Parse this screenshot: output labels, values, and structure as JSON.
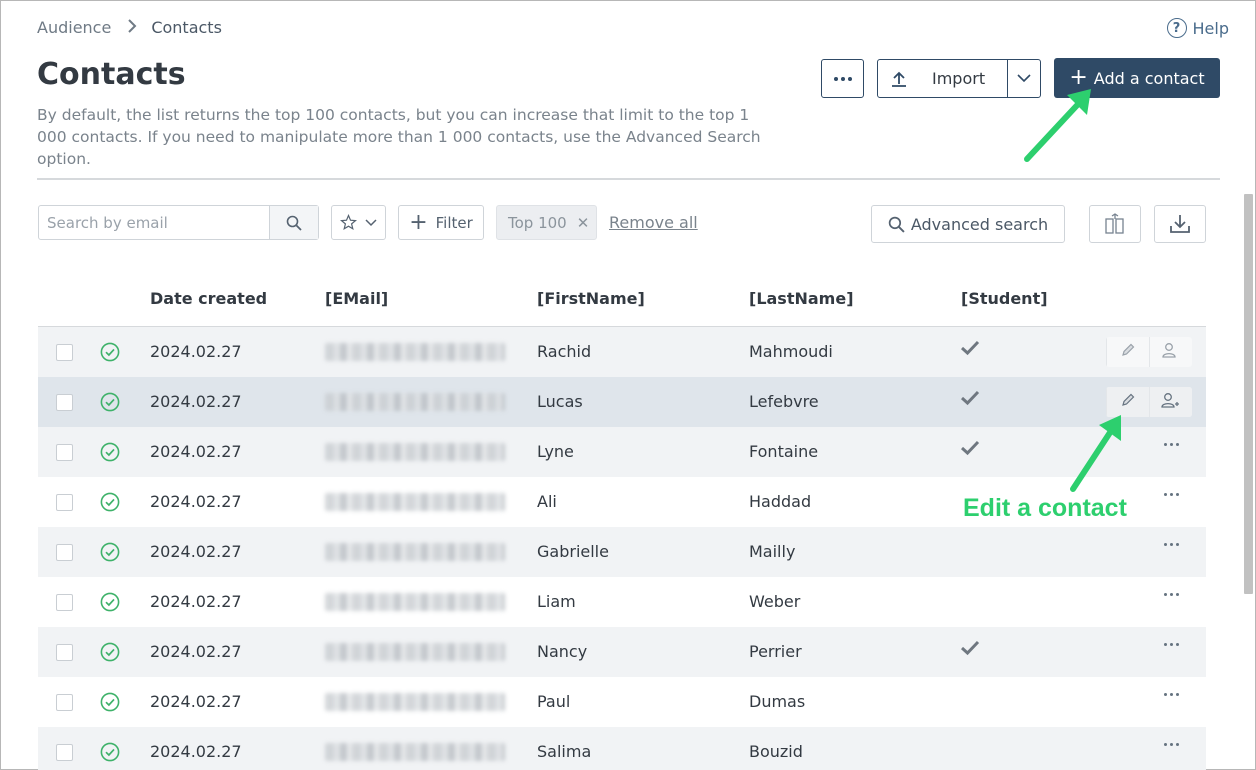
{
  "breadcrumb": {
    "parent": "Audience",
    "current": "Contacts"
  },
  "help_label": "Help",
  "page": {
    "title": "Contacts",
    "description": "By default, the list returns the top 100 contacts, but you can increase that limit to the top 1 000 contacts. If you need to manipulate more than 1 000 contacts, use the Advanced Search option."
  },
  "toolbar": {
    "import_label": "Import",
    "add_label": "Add a contact"
  },
  "filters": {
    "search_placeholder": "Search by email",
    "filter_label": "Filter",
    "chip_label": "Top 100",
    "remove_all_label": "Remove all",
    "advanced_search_label": "Advanced search"
  },
  "table": {
    "headers": [
      "Date created",
      "[EMail]",
      "[FirstName]",
      "[LastName]",
      "[Student]"
    ],
    "rows": [
      {
        "date": "2024.02.27",
        "first": "Rachid",
        "last": "Mahmoudi",
        "student": true
      },
      {
        "date": "2024.02.27",
        "first": "Lucas",
        "last": "Lefebvre",
        "student": true
      },
      {
        "date": "2024.02.27",
        "first": "Lyne",
        "last": "Fontaine",
        "student": true
      },
      {
        "date": "2024.02.27",
        "first": "Ali",
        "last": "Haddad",
        "student": false
      },
      {
        "date": "2024.02.27",
        "first": "Gabrielle",
        "last": "Mailly",
        "student": false
      },
      {
        "date": "2024.02.27",
        "first": "Liam",
        "last": "Weber",
        "student": false
      },
      {
        "date": "2024.02.27",
        "first": "Nancy",
        "last": "Perrier",
        "student": true
      },
      {
        "date": "2024.02.27",
        "first": "Paul",
        "last": "Dumas",
        "student": false
      },
      {
        "date": "2024.02.27",
        "first": "Salima",
        "last": "Bouzid",
        "student": false
      }
    ]
  },
  "annotation": {
    "edit_label": "Edit a contact"
  },
  "colors": {
    "primary": "#2f4a66",
    "accent_green": "#2dcf6e",
    "status_green": "#3fb26a"
  }
}
